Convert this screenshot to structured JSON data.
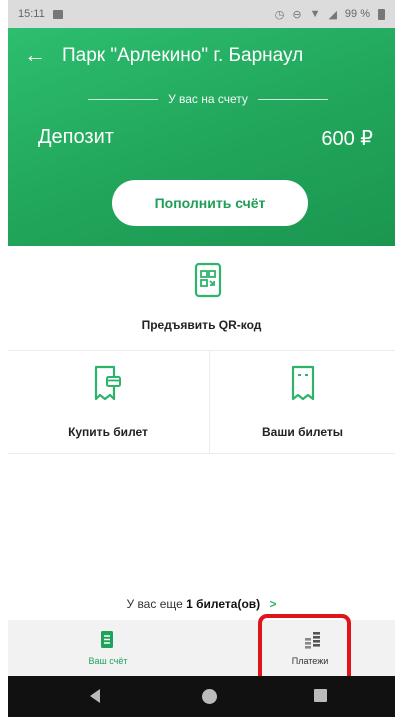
{
  "status_bar": {
    "time": "15:11",
    "battery": "99 %"
  },
  "header": {
    "title": "Парк \"Арлекино\" г. Барнаул",
    "balance_label": "У вас на счету",
    "deposit_label": "Депозит",
    "deposit_amount": "600 ₽",
    "topup_label": "Пополнить счёт"
  },
  "actions": {
    "qr_label": "Предъявить QR-код",
    "buy_ticket_label": "Купить билет",
    "your_tickets_label": "Ваши билеты"
  },
  "remaining": {
    "prefix": "У вас еще",
    "count": "1 билета(ов)",
    "chevron": ">"
  },
  "bottom_nav": {
    "account_label": "Ваш счёт",
    "payments_label": "Платежи"
  },
  "colors": {
    "brand_green": "#21a55b",
    "highlight_red": "#e0141c"
  }
}
